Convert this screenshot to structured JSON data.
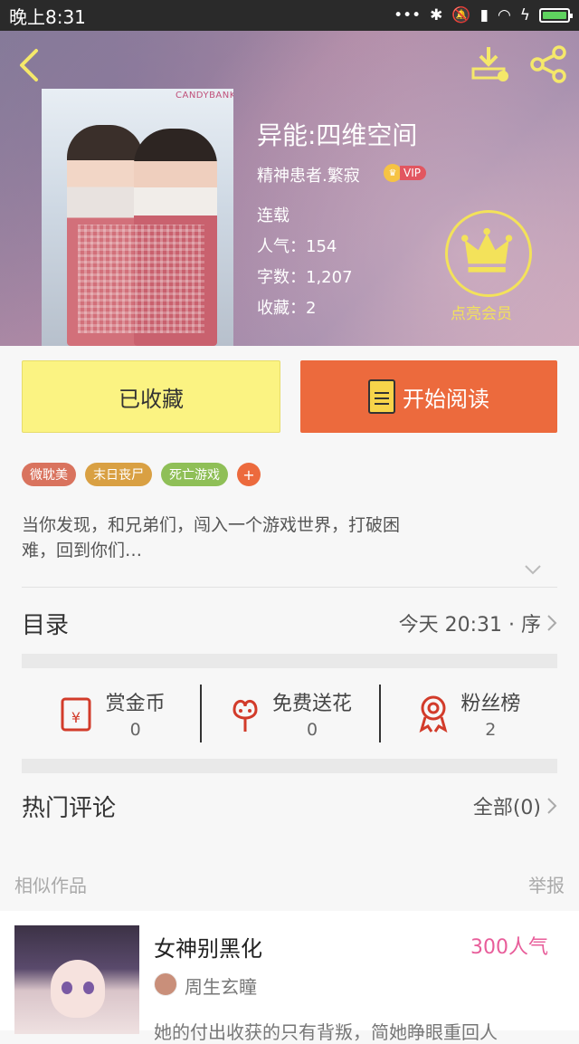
{
  "status_bar": {
    "time": "晚上8:31"
  },
  "book": {
    "title": "异能:四维空间",
    "author": "精神患者.繁寂",
    "vip_label": "VIP",
    "status": "连载",
    "popularity": "人气：154",
    "word_count": "字数：1,207",
    "favorites": "收藏：2",
    "cover_brand": "CANDYBANK",
    "description": "当你发现，和兄弟们，闯入一个游戏世界，打破困难，回到你们…"
  },
  "member": {
    "label": "点亮会员"
  },
  "actions": {
    "favorited_label": "已收藏",
    "read_label": "开始阅读"
  },
  "tags": [
    {
      "label": "微耽美",
      "color": "#d9735e"
    },
    {
      "label": "末日丧尸",
      "color": "#d9a043"
    },
    {
      "label": "死亡游戏",
      "color": "#8fbf57"
    }
  ],
  "tag_add": "+",
  "catalog": {
    "title": "目录",
    "latest": "今天 20:31 · 序"
  },
  "stats": [
    {
      "label": "赏金币",
      "value": "0"
    },
    {
      "label": "免费送花",
      "value": "0"
    },
    {
      "label": "粉丝榜",
      "value": "2"
    }
  ],
  "comments": {
    "title": "热门评论",
    "all": "全部(0)"
  },
  "similar": {
    "header": "相似作品",
    "report": "举报",
    "item": {
      "title": "女神别黑化",
      "popularity": "300人气",
      "author": "周生玄瞳",
      "snippet": "她的付出收获的只有背叛，简她睁眼重回人"
    }
  },
  "colors": {
    "accent_orange": "#ec6a3d",
    "fav_yellow": "#fbf382",
    "crown_yellow": "#f3e25a",
    "pink": "#e85d9a"
  }
}
